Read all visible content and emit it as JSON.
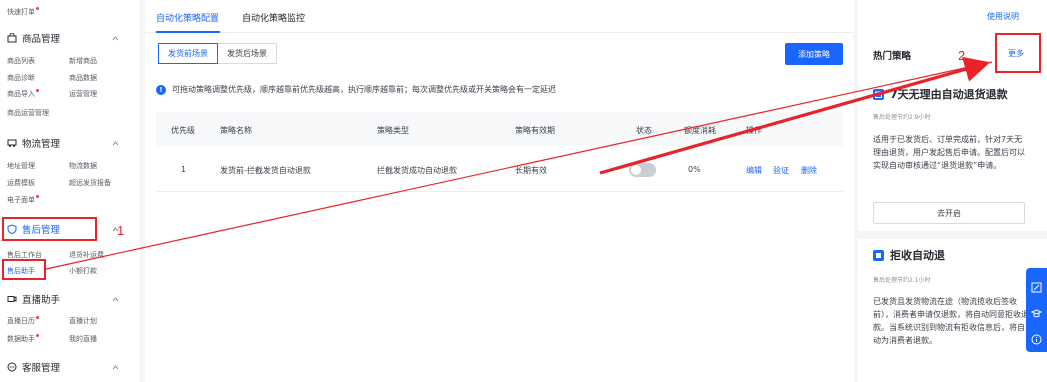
{
  "sidebar": {
    "top_item": "快速打单",
    "groups": [
      {
        "title": "商品管理",
        "items": [
          "商品列表",
          "新增商品",
          "商品诊断",
          "商品数据",
          "商品导入",
          "运营管理",
          "商品运营管理"
        ]
      },
      {
        "title": "物流管理",
        "items": [
          "地址管理",
          "物流数据",
          "运费模板",
          "超远发货报备",
          "电子面单"
        ]
      },
      {
        "title": "售后管理",
        "items": [
          "售后工作台",
          "退货补运费",
          "售后助手",
          "小额打款"
        ]
      },
      {
        "title": "直播助手",
        "items": [
          "直播日历",
          "直播计划",
          "数据助手",
          "我的直播"
        ]
      },
      {
        "title": "客服管理"
      }
    ]
  },
  "main": {
    "tabs": [
      "自动化策略配置",
      "自动化策略监控"
    ],
    "scenes": [
      "发货前场景",
      "发货后场景"
    ],
    "add_button": "添加策略",
    "notice": "可拖动策略调整优先级，顺序越靠前优先级越高，执行顺序越靠前；每次调整优先级或开关策略会有一定延迟",
    "table": {
      "headers": [
        "优先级",
        "策略名称",
        "策略类型",
        "策略有效期",
        "状态",
        "额度消耗",
        "操作"
      ],
      "rows": [
        {
          "priority": "1",
          "name": "发货前-拦截发货自动退款",
          "type": "拦截发货成功自动退款",
          "validity": "长期有效",
          "usage": "0%",
          "actions": [
            "编辑",
            "验证",
            "删除"
          ]
        }
      ]
    }
  },
  "right_panel": {
    "help_link": "使用说明",
    "title": "热门策略",
    "more_link": "更多",
    "cards": [
      {
        "title": "7天无理由自动退货退款",
        "sub": "售后处理节约2.9小时",
        "desc": "适用于已发货后、订单完成前，针对7天无理由退货，用户发起售后申请。配置后可以实现自动审核通过“退货退款”申请。",
        "button": "去开启"
      },
      {
        "title": "拒收自动退",
        "sub": "售后处理节约2.1小时",
        "desc": "已发货且发货物流在途（物流揽收后签收前），消费者申请仅退款，将自动同意拒收退款。当系统识别到物流有拒收信息后，将自动为消费者退款。"
      }
    ]
  },
  "annotations": {
    "step1": "1",
    "step2": "2"
  },
  "colors": {
    "accent": "#1966ff",
    "annotation": "#e8232a"
  }
}
